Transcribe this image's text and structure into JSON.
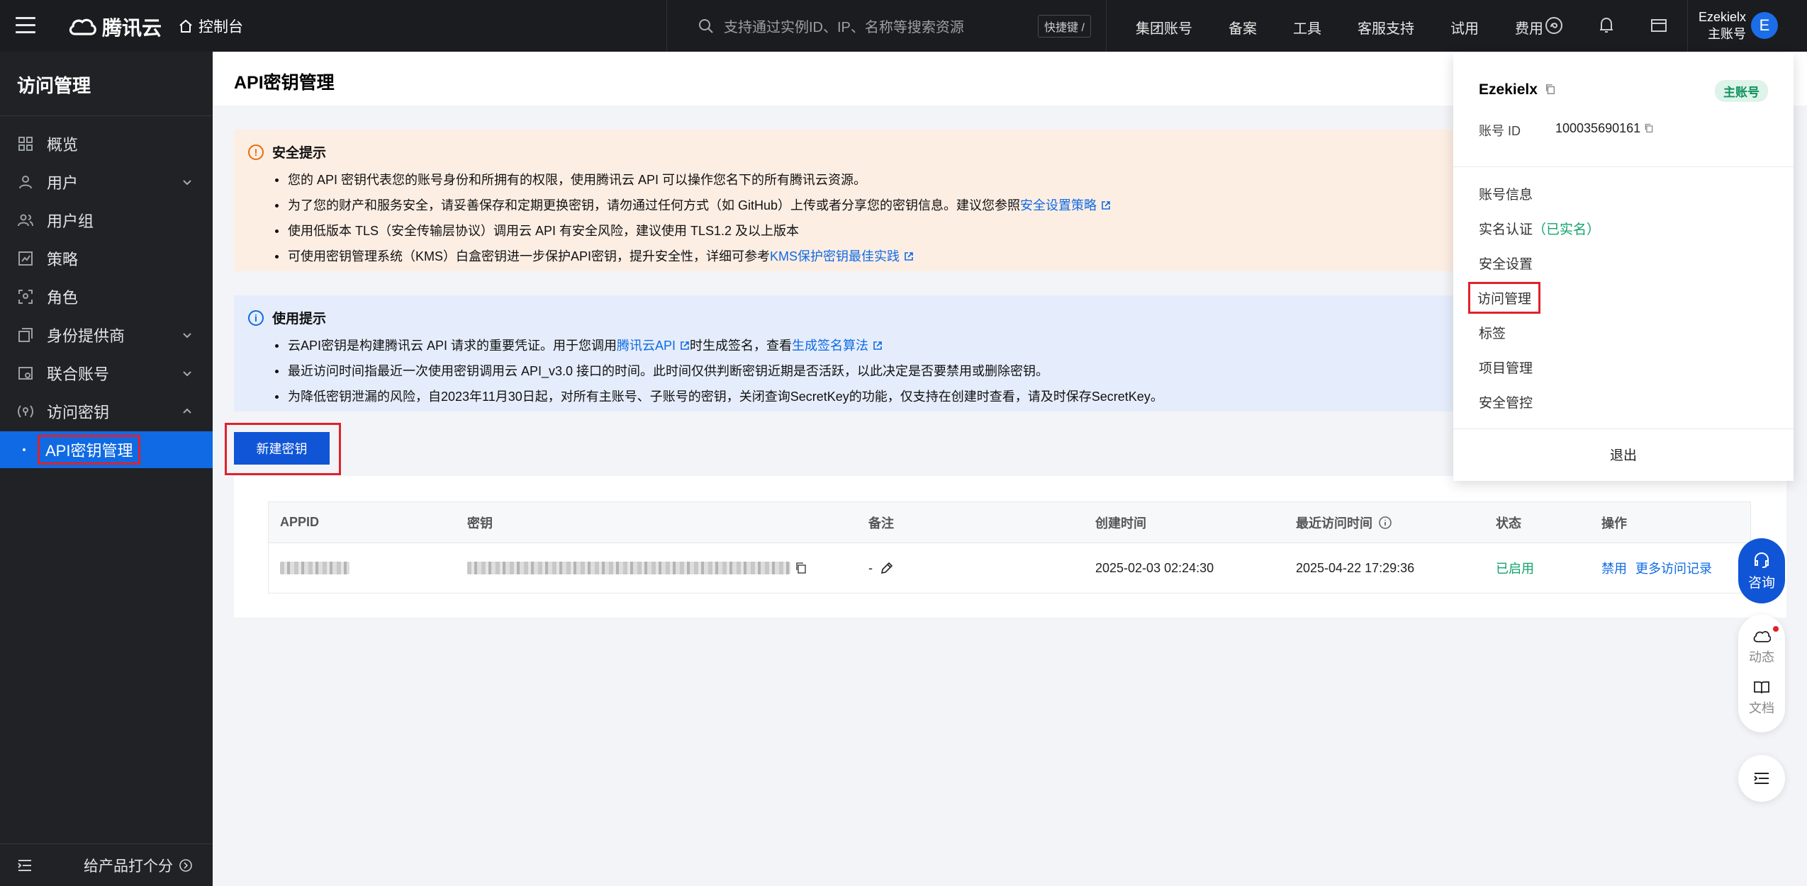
{
  "topbar": {
    "logo_text": "腾讯云",
    "console_label": "控制台",
    "search_placeholder": "支持通过实例ID、IP、名称等搜索资源",
    "shortcut_label": "快捷键 /",
    "nav": [
      "集团账号",
      "备案",
      "工具",
      "客服支持",
      "试用",
      "费用"
    ],
    "account_name": "Ezekielx",
    "account_role": "主账号",
    "avatar_letter": "E"
  },
  "sidebar": {
    "title": "访问管理",
    "items": [
      {
        "label": "概览",
        "icon": "grid-icon",
        "chevron": ""
      },
      {
        "label": "用户",
        "icon": "user-icon",
        "chevron": "down"
      },
      {
        "label": "用户组",
        "icon": "user-group-icon",
        "chevron": ""
      },
      {
        "label": "策略",
        "icon": "policy-icon",
        "chevron": ""
      },
      {
        "label": "角色",
        "icon": "role-icon",
        "chevron": ""
      },
      {
        "label": "身份提供商",
        "icon": "identity-provider-icon",
        "chevron": "down"
      },
      {
        "label": "联合账号",
        "icon": "federated-account-icon",
        "chevron": "down"
      },
      {
        "label": "访问密钥",
        "icon": "key-icon",
        "chevron": "up"
      },
      {
        "label": "API密钥管理",
        "icon": "",
        "chevron": "",
        "active": true
      }
    ],
    "bottom_label": "给产品打个分"
  },
  "page": {
    "title": "API密钥管理"
  },
  "security_alert": {
    "title": "安全提示",
    "items": [
      {
        "text": "您的 API 密钥代表您的账号身份和所拥有的权限，使用腾讯云 API 可以操作您名下的所有腾讯云资源。"
      },
      {
        "text": "为了您的财产和服务安全，请妥善保存和定期更换密钥，请勿通过任何方式（如 GitHub）上传或者分享您的密钥信息。建议您参照",
        "link": "安全设置策略"
      },
      {
        "text": "使用低版本 TLS（安全传输层协议）调用云 API 有安全风险，建议使用 TLS1.2 及以上版本"
      },
      {
        "text": "可使用密钥管理系统（KMS）白盒密钥进一步保护API密钥，提升安全性，详细可参考",
        "link": "KMS保护密钥最佳实践"
      }
    ]
  },
  "usage_alert": {
    "title": "使用提示",
    "item1_pre": "云API密钥是构建腾讯云 API 请求的重要凭证。用于您调用",
    "item1_link1": "腾讯云API",
    "item1_mid": "时生成签名，查看",
    "item1_link2": "生成签名算法",
    "item2": "最近访问时间指最近一次使用密钥调用云 API_v3.0 接口的时间。此时间仅供判断密钥近期是否活跃，以此决定是否要禁用或删除密钥。",
    "item3": "为降低密钥泄漏的风险，自2023年11月30日起，对所有主账号、子账号的密钥，关闭查询SecretKey的功能，仅支持在创建时查看，请及时保存SecretKey。"
  },
  "new_key_button": "新建密钥",
  "table": {
    "headers": [
      "APPID",
      "密钥",
      "备注",
      "创建时间",
      "最近访问时间",
      "状态",
      "操作"
    ],
    "row": {
      "remark": "-",
      "created": "2025-02-03 02:24:30",
      "last_access": "2025-04-22 17:29:36",
      "status": "已启用",
      "action_disable": "禁用",
      "action_more": "更多访问记录"
    }
  },
  "dropdown": {
    "name": "Ezekielx",
    "badge": "主账号",
    "id_label": "账号 ID",
    "id_value": "100035690161",
    "items": [
      "账号信息",
      "实名认证",
      "安全设置",
      "访问管理",
      "标签",
      "项目管理",
      "安全管控"
    ],
    "verified_note": "（已实名）",
    "logout": "退出"
  },
  "float_tools": {
    "consult": "咨询",
    "dynamic": "动态",
    "docs": "文档"
  },
  "colors": {
    "accent": "#0f6ae3",
    "sidebar_bg": "#212225",
    "topbar_bg": "#1b1c1f",
    "warn_bg": "#fdeee4",
    "info_bg": "#e5edfc",
    "highlight": "#e0222b",
    "success": "#11a36b"
  }
}
